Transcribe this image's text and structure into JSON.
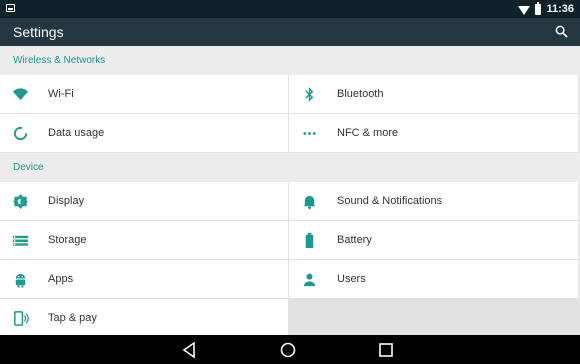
{
  "status_bar": {
    "time": "11:36"
  },
  "app_bar": {
    "title": "Settings"
  },
  "sections": {
    "wireless": "Wireless & Networks",
    "device": "Device"
  },
  "tiles": {
    "wifi": "Wi-Fi",
    "bluetooth": "Bluetooth",
    "data_usage": "Data usage",
    "nfc": "NFC & more",
    "display": "Display",
    "sound": "Sound & Notifications",
    "storage": "Storage",
    "battery": "Battery",
    "apps": "Apps",
    "users": "Users",
    "tap_pay": "Tap & pay"
  },
  "colors": {
    "accent": "#1a9a90",
    "app_bar": "#243640",
    "status_bar": "#0f2229"
  },
  "icons": {
    "wifi": "wifi-icon",
    "bluetooth": "bluetooth-icon",
    "data_usage": "data-usage-icon",
    "nfc": "more-dots-icon",
    "display": "display-brightness-icon",
    "sound": "bell-icon",
    "storage": "storage-list-icon",
    "battery": "battery-icon",
    "apps": "android-icon",
    "users": "person-icon",
    "tap_pay": "tap-pay-icon"
  }
}
